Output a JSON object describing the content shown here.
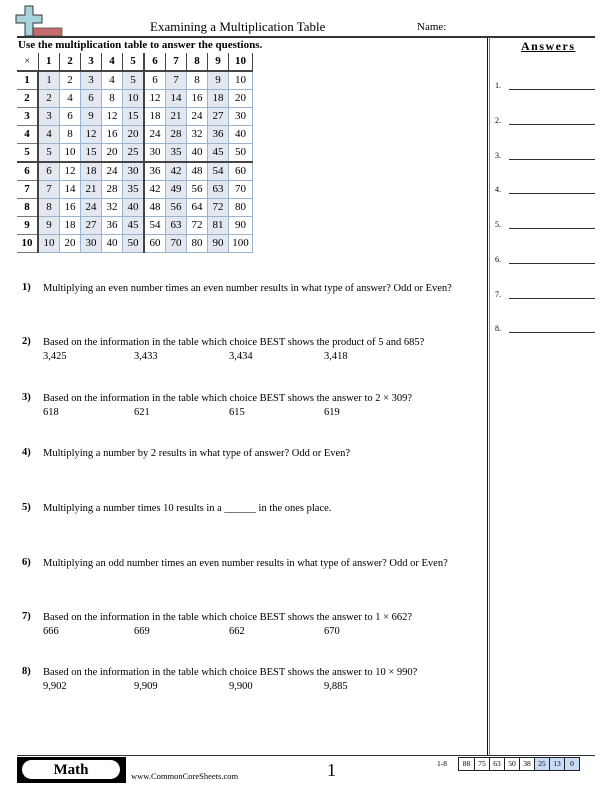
{
  "header": {
    "title": "Examining a Multiplication Table",
    "name_label": "Name:",
    "logo_colors": {
      "plus": "#a8d4dc",
      "bar": "#c26c6c"
    }
  },
  "instructions": "Use the multiplication table to answer the questions.",
  "table": {
    "corner": "×",
    "col_headers": [
      "1",
      "2",
      "3",
      "4",
      "5",
      "6",
      "7",
      "8",
      "9",
      "10"
    ],
    "rows": [
      {
        "header": "1",
        "cells": [
          "1",
          "2",
          "3",
          "4",
          "5",
          "6",
          "7",
          "8",
          "9",
          "10"
        ]
      },
      {
        "header": "2",
        "cells": [
          "2",
          "4",
          "6",
          "8",
          "10",
          "12",
          "14",
          "16",
          "18",
          "20"
        ]
      },
      {
        "header": "3",
        "cells": [
          "3",
          "6",
          "9",
          "12",
          "15",
          "18",
          "21",
          "24",
          "27",
          "30"
        ]
      },
      {
        "header": "4",
        "cells": [
          "4",
          "8",
          "12",
          "16",
          "20",
          "24",
          "28",
          "32",
          "36",
          "40"
        ]
      },
      {
        "header": "5",
        "cells": [
          "5",
          "10",
          "15",
          "20",
          "25",
          "30",
          "35",
          "40",
          "45",
          "50"
        ]
      },
      {
        "header": "6",
        "cells": [
          "6",
          "12",
          "18",
          "24",
          "30",
          "36",
          "42",
          "48",
          "54",
          "60"
        ]
      },
      {
        "header": "7",
        "cells": [
          "7",
          "14",
          "21",
          "28",
          "35",
          "42",
          "49",
          "56",
          "63",
          "70"
        ]
      },
      {
        "header": "8",
        "cells": [
          "8",
          "16",
          "24",
          "32",
          "40",
          "48",
          "56",
          "64",
          "72",
          "80"
        ]
      },
      {
        "header": "9",
        "cells": [
          "9",
          "18",
          "27",
          "36",
          "45",
          "54",
          "63",
          "72",
          "81",
          "90"
        ]
      },
      {
        "header": "10",
        "cells": [
          "10",
          "20",
          "30",
          "40",
          "50",
          "60",
          "70",
          "80",
          "90",
          "100"
        ]
      }
    ],
    "shaded_columns": [
      1,
      3,
      5,
      7,
      9
    ],
    "shade_color": "#e3e7ef"
  },
  "answers": {
    "title": "Answers",
    "items": [
      "1.",
      "2.",
      "3.",
      "4.",
      "5.",
      "6.",
      "7.",
      "8."
    ]
  },
  "questions": [
    {
      "num": "1)",
      "text": "Multiplying an even number times an even number results in what type of answer? Odd or Even?",
      "choices": []
    },
    {
      "num": "2)",
      "text": "Based on the information in the table which choice BEST shows the product of 5 and 685?",
      "choices": [
        "3,425",
        "3,433",
        "3,434",
        "3,418"
      ]
    },
    {
      "num": "3)",
      "text": "Based on the information in the table which choice BEST shows the answer to 2 × 309?",
      "choices": [
        "618",
        "621",
        "615",
        "619"
      ]
    },
    {
      "num": "4)",
      "text": "Multiplying a number by 2 results in what type of answer? Odd or Even?",
      "choices": []
    },
    {
      "num": "5)",
      "text": "Multiplying a number times 10 results in a ______ in the ones place.",
      "choices": []
    },
    {
      "num": "6)",
      "text": "Multiplying an odd number times an even number results in what type of answer? Odd or Even?",
      "choices": []
    },
    {
      "num": "7)",
      "text": "Based on the information in the table which choice BEST shows the answer to 1 × 662?",
      "choices": [
        "666",
        "669",
        "662",
        "670"
      ]
    },
    {
      "num": "8)",
      "text": "Based on the information in the table which choice BEST shows the answer to 10 × 990?",
      "choices": [
        "9,902",
        "9,909",
        "9,900",
        "9,885"
      ]
    }
  ],
  "footer": {
    "subject": "Math",
    "site": "www.CommonCoreSheets.com",
    "page": "1",
    "score_label": "1-8",
    "scores": [
      "88",
      "75",
      "63",
      "50",
      "38",
      "25",
      "13",
      "0"
    ],
    "highlighted_scores": [
      "25",
      "13",
      "0"
    ],
    "highlight_color": "#c9dcf7"
  }
}
